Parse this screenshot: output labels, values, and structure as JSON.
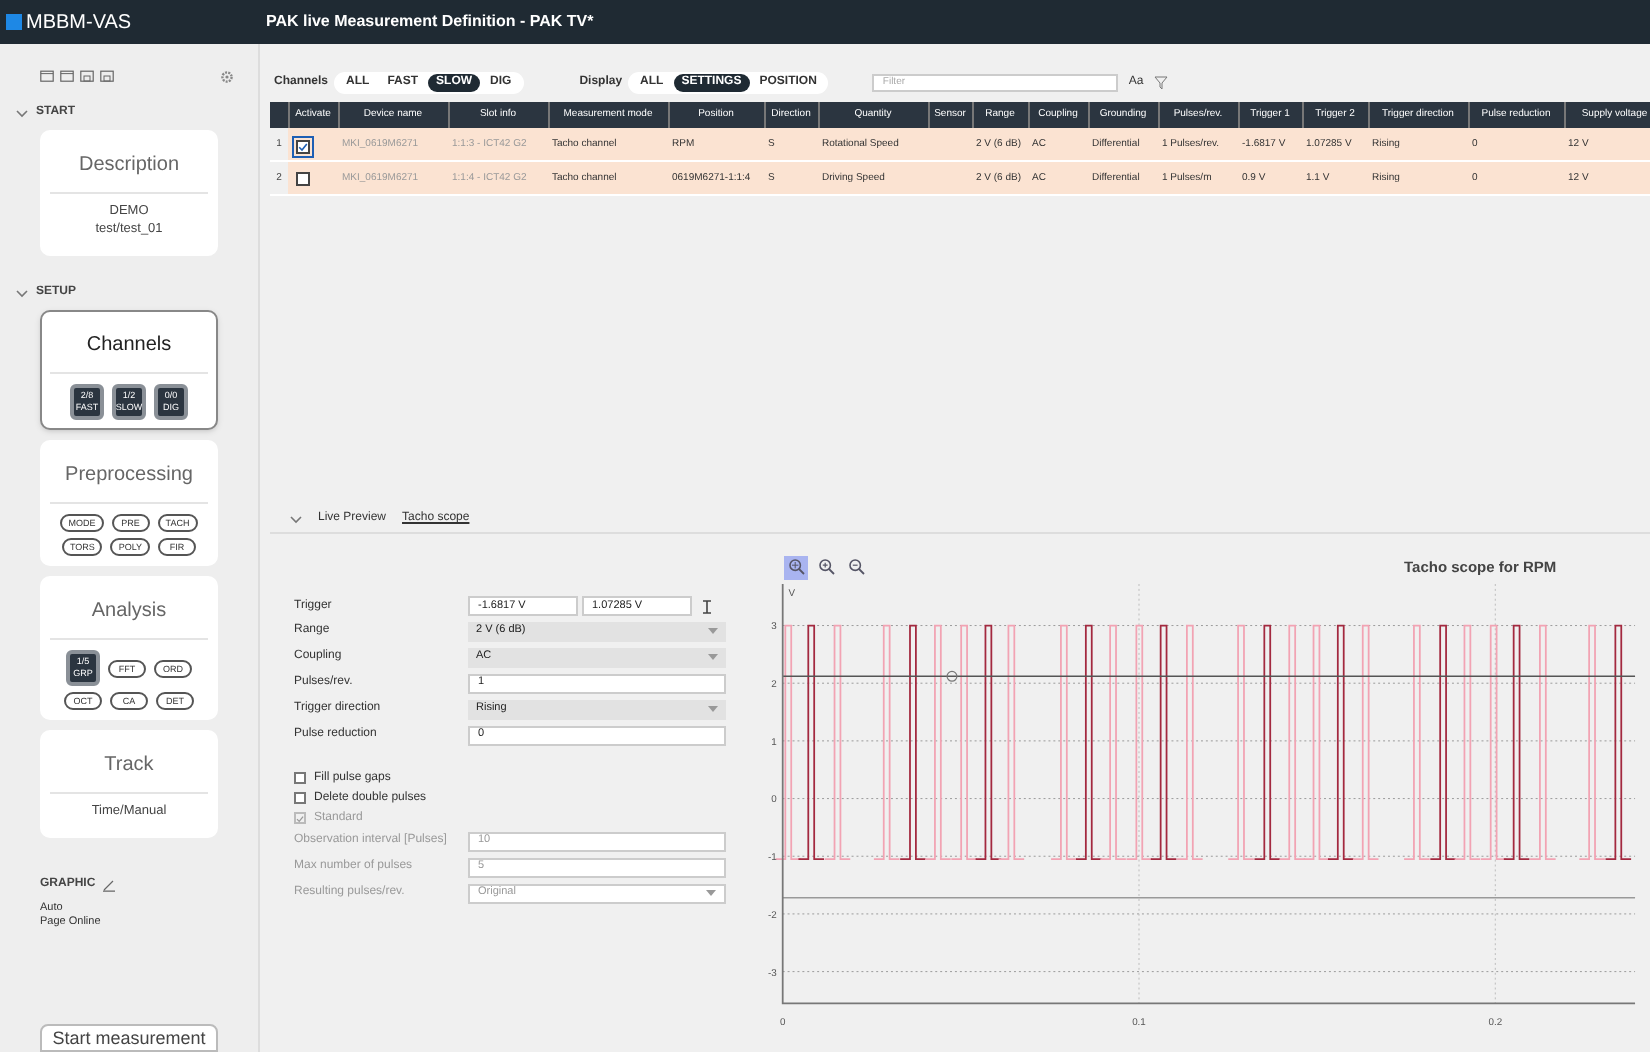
{
  "app": {
    "name": "MBBM-VAS",
    "title": "PAK live Measurement Definition - PAK TV*"
  },
  "sidebar": {
    "sections": [
      {
        "label": "START",
        "cards": [
          {
            "title": "Description",
            "selected": false,
            "lines": [
              "DEMO",
              "test/test_01"
            ]
          }
        ]
      },
      {
        "label": "SETUP",
        "cards": [
          {
            "title": "Channels",
            "selected": true,
            "badges": [
              {
                "kind": "counter",
                "count": "2/8",
                "label": "FAST"
              },
              {
                "kind": "counter",
                "count": "1/2",
                "label": "SLOW"
              },
              {
                "kind": "counter",
                "count": "0/0",
                "label": "DIG"
              }
            ]
          },
          {
            "title": "Preprocessing",
            "selected": false,
            "badges": [
              {
                "kind": "pill",
                "label": "MODE"
              },
              {
                "kind": "pill",
                "label": "PRE"
              },
              {
                "kind": "pill",
                "label": "TACH"
              },
              {
                "kind": "pill",
                "label": "TORS"
              },
              {
                "kind": "pill",
                "label": "POLY"
              },
              {
                "kind": "pill",
                "label": "FIR"
              }
            ]
          },
          {
            "title": "Analysis",
            "selected": false,
            "badges": [
              {
                "kind": "counter",
                "count": "1/5",
                "label": "GRP"
              },
              {
                "kind": "pill",
                "label": "FFT"
              },
              {
                "kind": "pill",
                "label": "ORD"
              },
              {
                "kind": "pill",
                "label": "OCT"
              },
              {
                "kind": "pill",
                "label": "CA"
              },
              {
                "kind": "pill",
                "label": "DET"
              }
            ]
          },
          {
            "title": "Track",
            "selected": false,
            "lines": [
              "Time/Manual"
            ]
          }
        ]
      }
    ],
    "graphic": {
      "label": "GRAPHIC",
      "lines": [
        "Auto",
        "Page Online"
      ]
    },
    "start_button": "Start measurement"
  },
  "toolbar": {
    "channels": {
      "label": "Channels",
      "options": [
        {
          "label": "ALL",
          "selected": false
        },
        {
          "label": "FAST",
          "selected": false
        },
        {
          "label": "SLOW",
          "selected": true
        },
        {
          "label": "DIG",
          "selected": false
        }
      ]
    },
    "display": {
      "label": "Display",
      "options": [
        {
          "label": "ALL",
          "selected": false
        },
        {
          "label": "SETTINGS",
          "selected": true
        },
        {
          "label": "POSITION",
          "selected": false
        }
      ]
    },
    "filter": {
      "placeholder": "Filter"
    },
    "case_toggle": "Aa"
  },
  "table": {
    "activate_column": "Activate",
    "columns": [
      "Device name",
      "Slot info",
      "Measurement mode",
      "Position",
      "Direction",
      "Quantity",
      "Sensor",
      "Range",
      "Coupling",
      "Grounding",
      "Pulses/rev.",
      "Trigger 1",
      "Trigger 2",
      "Trigger direction",
      "Pulse reduction",
      "Supply voltage"
    ],
    "rows": [
      {
        "number": "1",
        "selected": true,
        "checked": true,
        "cells": [
          "MKI_0619M6271",
          "1:1:3 - ICT42 G2",
          "Tacho channel",
          "RPM",
          "S",
          "Rotational Speed",
          null,
          "2 V (6 dB)",
          "AC",
          "Differential",
          "1 Pulses/rev.",
          "-1.6817 V",
          "1.07285 V",
          "Rising",
          "0",
          "12 V"
        ]
      },
      {
        "number": "2",
        "selected": false,
        "checked": false,
        "cells": [
          "MKI_0619M6271",
          "1:1:4 - ICT42 G2",
          "Tacho channel",
          "0619M6271-1:1:4",
          "S",
          "Driving Speed",
          null,
          "2 V (6 dB)",
          "AC",
          "Differential",
          "1 Pulses/m",
          "0.9 V",
          "1.1 V",
          "Rising",
          "0",
          "12 V"
        ]
      }
    ]
  },
  "preview": {
    "tabs": [
      {
        "label": "Live Preview",
        "selected": false
      },
      {
        "label": "Tacho scope",
        "selected": true
      }
    ],
    "form": [
      {
        "kind": "dual",
        "label": "Trigger",
        "values": [
          "-1.6817 V",
          "1.07285 V"
        ]
      },
      {
        "kind": "select",
        "label": "Range",
        "value": "2 V (6 dB)",
        "disabled": false
      },
      {
        "kind": "select",
        "label": "Coupling",
        "value": "AC",
        "disabled": false
      },
      {
        "kind": "input",
        "label": "Pulses/rev.",
        "value": "1",
        "disabled": false
      },
      {
        "kind": "select",
        "label": "Trigger direction",
        "value": "Rising",
        "disabled": false
      },
      {
        "kind": "input",
        "label": "Pulse reduction",
        "value": "0",
        "disabled": false
      },
      {
        "kind": "checkbox",
        "label": "Fill pulse gaps",
        "checked": false,
        "disabled": false
      },
      {
        "kind": "checkbox",
        "label": "Delete double pulses",
        "checked": false,
        "disabled": false
      },
      {
        "kind": "checkbox",
        "label": "Standard",
        "checked": true,
        "disabled": true
      },
      {
        "kind": "input",
        "label": "Observation interval [Pulses]",
        "value": "10",
        "disabled": true
      },
      {
        "kind": "input",
        "label": "Max number of pulses",
        "value": "5",
        "disabled": true
      },
      {
        "kind": "select",
        "label": "Resulting pulses/rev.",
        "value": "Original",
        "disabled": true
      }
    ],
    "scope": {
      "title": "Tacho scope for RPM",
      "tools": [
        {
          "kind": "select",
          "selected": true
        },
        {
          "kind": "zoom-in",
          "selected": false
        },
        {
          "kind": "zoom-out",
          "selected": false
        }
      ],
      "y_unit": "V",
      "y_ticks": [
        "3",
        "2",
        "1",
        "0",
        "-1",
        "-2",
        "-3"
      ],
      "x_ticks": [
        "0",
        "0.1",
        "0.2"
      ]
    }
  }
}
